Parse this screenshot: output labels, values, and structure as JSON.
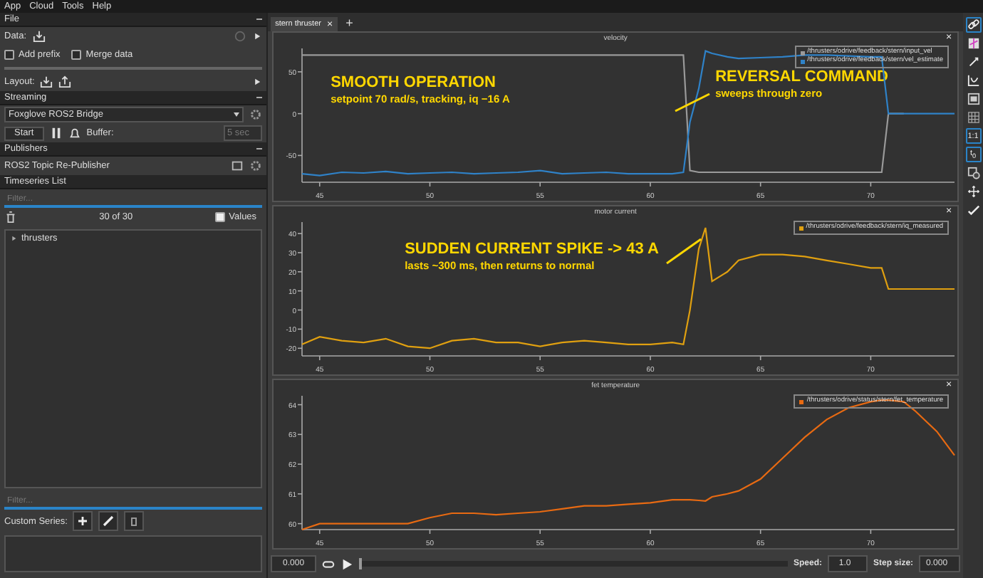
{
  "menu": [
    "App",
    "Cloud",
    "Tools",
    "Help"
  ],
  "sidebar": {
    "file": {
      "title": "File",
      "data_label": "Data:",
      "checkboxes": [
        {
          "label": "Add prefix",
          "checked": false
        },
        {
          "label": "Merge data",
          "checked": false
        }
      ],
      "layout_label": "Layout:"
    },
    "streaming": {
      "title": "Streaming",
      "source": "Foxglove ROS2 Bridge",
      "start": "Start",
      "buffer_label": "Buffer:",
      "buffer": "5 sec"
    },
    "publishers": {
      "title": "Publishers",
      "item": "ROS2 Topic Re-Publisher"
    },
    "timeseries": {
      "title": "Timeseries List",
      "filter": {
        "placeholder": "Filter..."
      },
      "count": "30 of 30",
      "values": {
        "label": "Values",
        "checked": true
      },
      "tree": [
        {
          "label": "thrusters",
          "expanded": false
        }
      ],
      "filter2": {
        "placeholder": "Filter..."
      },
      "custom_label": "Custom Series:"
    }
  },
  "tabs": [
    {
      "label": "stern thruster",
      "selected": true,
      "close": "×"
    }
  ],
  "add_tab": "+",
  "plots": [
    {
      "close": "×",
      "chart_data": {
        "type": "line",
        "title": "velocity",
        "x": [
          44.2,
          45,
          46,
          47,
          48,
          49,
          50,
          51,
          52,
          53,
          54,
          55,
          56,
          57,
          58,
          59,
          60,
          61,
          61.5,
          61.8,
          62.2,
          62.5,
          62.8,
          63.5,
          64,
          65,
          66,
          67,
          68,
          69,
          70,
          70.5,
          70.8,
          71.5,
          72,
          73,
          73.8
        ],
        "series": [
          {
            "name": "/thrusters/odrive/feedback/stern/input_vel",
            "color": "#9a9a9a",
            "values": [
              70,
              70,
              70,
              70,
              70,
              70,
              70,
              70,
              70,
              70,
              70,
              70,
              70,
              70,
              70,
              70,
              70,
              70,
              70,
              -68,
              -70,
              -70,
              -70,
              -70,
              -70,
              -70,
              -70,
              -70,
              -70,
              -70,
              -70,
              -70,
              0,
              0,
              null,
              null,
              null
            ]
          },
          {
            "name": "/thrusters/odrive/feedback/stern/vel_estimate",
            "color": "#2f82c8",
            "values": [
              -72,
              -74,
              -70,
              -71,
              -69,
              -72,
              -71,
              -70,
              -72,
              -71,
              -70,
              -68,
              -72,
              -71,
              -70,
              -72,
              -72,
              -72,
              -70,
              -10,
              30,
              75,
              72,
              68,
              66,
              67,
              68,
              70,
              70,
              69,
              68,
              68,
              0,
              0,
              0,
              0,
              0
            ]
          }
        ],
        "xlim": [
          44.2,
          73.8
        ],
        "ylim": [
          -82,
          78
        ],
        "xticks": [
          45,
          50,
          55,
          60,
          65,
          70
        ],
        "yticks": [
          -50,
          0,
          50
        ],
        "legend": "upper right"
      },
      "notes": [
        {
          "kind": "note",
          "title": "SMOOTH OPERATION",
          "subtitle": "setpoint 70 rad/s, tracking, iq −16 A"
        },
        {
          "kind": "callout",
          "title": "REVERSAL COMMAND",
          "subtitle": "sweeps through zero"
        }
      ]
    },
    {
      "close": "×",
      "chart_data": {
        "type": "line",
        "title": "motor current",
        "x": [
          44.2,
          45,
          46,
          47,
          48,
          49,
          50,
          51,
          52,
          53,
          54,
          55,
          56,
          57,
          58,
          59,
          60,
          61,
          61.5,
          61.8,
          62.2,
          62.5,
          62.8,
          63.5,
          64,
          65,
          66,
          67,
          68,
          69,
          70,
          70.5,
          70.8,
          71.5,
          72,
          73,
          73.8
        ],
        "series": [
          {
            "name": "/thrusters/odrive/feedback/stern/iq_measured",
            "color": "#e0a010",
            "values": [
              -18,
              -14,
              -16,
              -17,
              -15,
              -19,
              -20,
              -16,
              -15,
              -17,
              -17,
              -19,
              -17,
              -16,
              -17,
              -18,
              -18,
              -17,
              -18,
              0,
              32,
              43,
              15,
              20,
              26,
              29,
              29,
              28,
              26,
              24,
              22,
              22,
              11,
              11,
              11,
              11,
              11
            ]
          }
        ],
        "xlim": [
          44.2,
          73.8
        ],
        "ylim": [
          -24,
          46
        ],
        "xticks": [
          45,
          50,
          55,
          60,
          65,
          70
        ],
        "yticks": [
          -20,
          -10,
          0,
          10,
          20,
          30,
          40
        ],
        "legend": "upper right"
      },
      "notes": [
        {
          "kind": "callout",
          "title": "SUDDEN CURRENT SPIKE -> 43 A",
          "subtitle": "lasts ~300 ms, then returns to normal"
        }
      ]
    },
    {
      "close": "×",
      "chart_data": {
        "type": "line",
        "title": "fet temperature",
        "x": [
          44.2,
          45,
          46,
          47,
          48,
          49,
          50,
          51,
          52,
          53,
          54,
          55,
          56,
          57,
          58,
          59,
          60,
          61,
          61.5,
          61.8,
          62.2,
          62.5,
          62.8,
          63.5,
          64,
          65,
          66,
          67,
          68,
          69,
          70,
          70.5,
          70.8,
          71.5,
          72,
          73,
          73.8
        ],
        "series": [
          {
            "name": "/thrusters/odrive/status/stern/fet_temperature",
            "color": "#e86a12",
            "values": [
              59.8,
              60,
              60,
              60,
              60,
              60,
              60.2,
              60.35,
              60.35,
              60.3,
              60.35,
              60.4,
              60.5,
              60.6,
              60.6,
              60.65,
              60.7,
              60.8,
              60.8,
              60.8,
              60.78,
              60.76,
              60.9,
              61,
              61.1,
              61.5,
              62.2,
              62.9,
              63.5,
              63.9,
              64.1,
              64.15,
              64.15,
              64.1,
              63.8,
              63.1,
              62.3
            ]
          }
        ],
        "xlim": [
          44.2,
          73.8
        ],
        "ylim": [
          59.8,
          64.3
        ],
        "xticks": [
          45,
          50,
          55,
          60,
          65,
          70
        ],
        "yticks": [
          60,
          61,
          62,
          63,
          64
        ],
        "legend": "upper right"
      }
    }
  ],
  "toolbar": [
    {
      "kind": "icon",
      "active": true
    },
    {
      "kind": "icon",
      "active": false
    },
    {
      "kind": "icon",
      "active": false
    },
    {
      "kind": "icon",
      "active": false
    },
    {
      "kind": "icon",
      "active": false
    },
    {
      "kind": "icon",
      "active": false
    },
    {
      "kind": "text",
      "label": "1:1",
      "active": true
    },
    {
      "kind": "text",
      "label": "t$_{0}$",
      "active": true
    },
    {
      "kind": "icon",
      "active": false
    },
    {
      "kind": "icon",
      "active": false
    },
    {
      "kind": "icon",
      "active": false
    }
  ],
  "player": {
    "time": "0.000",
    "level": 0,
    "speed_label": "Speed:",
    "speed": "1.0",
    "step_label": "Step size:",
    "step": "0.000"
  }
}
